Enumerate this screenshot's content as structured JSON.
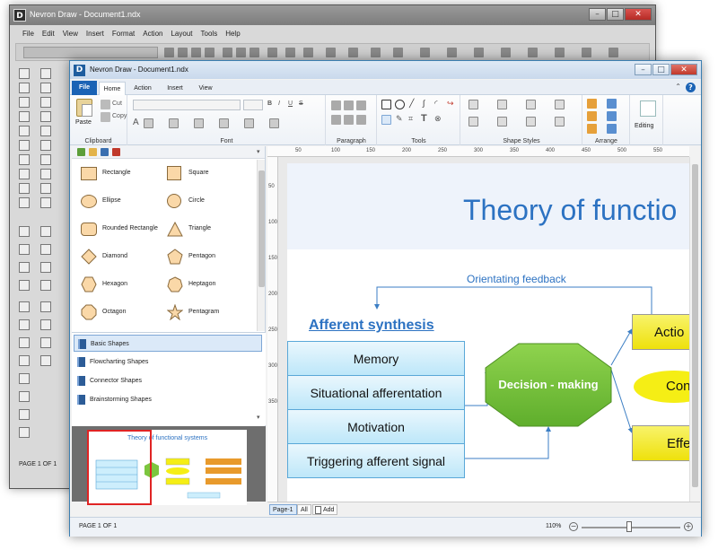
{
  "colors": {
    "ribbon_blue": "#1b63b5",
    "title_blue": "#2c72c2",
    "box_top": "#e8f6fd",
    "box_bottom": "#bfe8fa",
    "box_border": "#5aa8d8",
    "octagon_green": "#7cc63e",
    "action_yellow": "#f5ee15"
  },
  "bg_window": {
    "title": "Nevron Draw - Document1.ndx",
    "menu": [
      "File",
      "Edit",
      "View",
      "Insert",
      "Format",
      "Action",
      "Layout",
      "Tools",
      "Help"
    ],
    "status": "PAGE 1 OF 1"
  },
  "fg_window": {
    "title": "Nevron Draw - Document1.ndx",
    "tabs": [
      "File",
      "Home",
      "Action",
      "Insert",
      "View"
    ],
    "help_icon": "?",
    "ribbon_groups": {
      "clipboard": {
        "label": "Clipboard",
        "paste": "Paste",
        "cut": "Cut",
        "copy": "Copy"
      },
      "font": {
        "label": "Font"
      },
      "paragraph": {
        "label": "Paragraph"
      },
      "tools": {
        "label": "Tools"
      },
      "shape_styles": {
        "label": "Shape Styles"
      },
      "arrange": {
        "label": "Arrange"
      },
      "editing": {
        "label": "Editing"
      }
    }
  },
  "shapes": [
    {
      "label": "Rectangle",
      "icon": "rectangle-icon"
    },
    {
      "label": "Square",
      "icon": "square-icon"
    },
    {
      "label": "Ellipse",
      "icon": "ellipse-icon"
    },
    {
      "label": "Circle",
      "icon": "circle-icon"
    },
    {
      "label": "Rounded Rectangle",
      "icon": "rounded-rectangle-icon"
    },
    {
      "label": "Triangle",
      "icon": "triangle-icon"
    },
    {
      "label": "Diamond",
      "icon": "diamond-icon"
    },
    {
      "label": "Pentagon",
      "icon": "pentagon-icon"
    },
    {
      "label": "Hexagon",
      "icon": "hexagon-icon"
    },
    {
      "label": "Heptagon",
      "icon": "heptagon-icon"
    },
    {
      "label": "Octagon",
      "icon": "octagon-icon"
    },
    {
      "label": "Pentagram",
      "icon": "pentagram-icon"
    }
  ],
  "libraries": [
    "Basic Shapes",
    "Flowcharting Shapes",
    "Connector Shapes",
    "Brainstorming Shapes"
  ],
  "thumbnail_title": "Theory of functional systems",
  "ruler": {
    "h": [
      "50",
      "100",
      "150",
      "200",
      "250",
      "300",
      "350",
      "400",
      "450",
      "500",
      "550"
    ],
    "v": [
      "50",
      "100",
      "150",
      "200",
      "250",
      "300",
      "350"
    ]
  },
  "diagram": {
    "title": "Theory of functio",
    "feedback": "Orientating feedback",
    "afferent_heading": "Afferent synthesis",
    "boxes": [
      "Memory",
      "Situational afferentation",
      "Motivation",
      "Triggering afferent signal"
    ],
    "decision": "Decision - making",
    "action": "Actio",
    "con": "Con",
    "effe": "Effe"
  },
  "page_tabs": {
    "page": "Page-1",
    "all": "All",
    "add": "Add"
  },
  "status": {
    "page": "PAGE 1 OF 1",
    "zoom": "110%"
  }
}
